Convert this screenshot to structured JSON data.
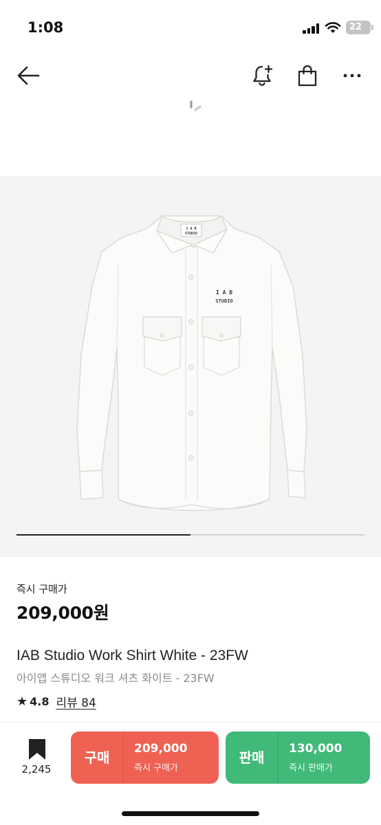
{
  "status_bar": {
    "time": "1:08",
    "battery": "22"
  },
  "nav": {
    "icons": [
      "back-arrow-icon",
      "bell-plus-icon",
      "shopping-bag-icon",
      "more-horizontal-icon"
    ]
  },
  "gallery": {
    "progress_fraction": 0.5,
    "shirt_logo_line1": "I A B",
    "shirt_logo_line2": "STUDIO",
    "shirt_tag_line1": "I A B",
    "shirt_tag_line2": "STUDIO"
  },
  "product": {
    "price_label": "즉시 구매가",
    "price": "209,000원",
    "title": "IAB Studio Work Shirt White - 23FW",
    "subtitle": "아이앱 스튜디오 워크 셔츠 화이트 - 23FW",
    "rating": "4.8",
    "review_link": "리뷰 84"
  },
  "bottom_bar": {
    "bookmark_count": "2,245",
    "buy": {
      "label": "구매",
      "price": "209,000",
      "sub": "즉시 구매가",
      "color": "#ef6253"
    },
    "sell": {
      "label": "판매",
      "price": "130,000",
      "sub": "즉시 판매가",
      "color": "#41b979"
    }
  }
}
